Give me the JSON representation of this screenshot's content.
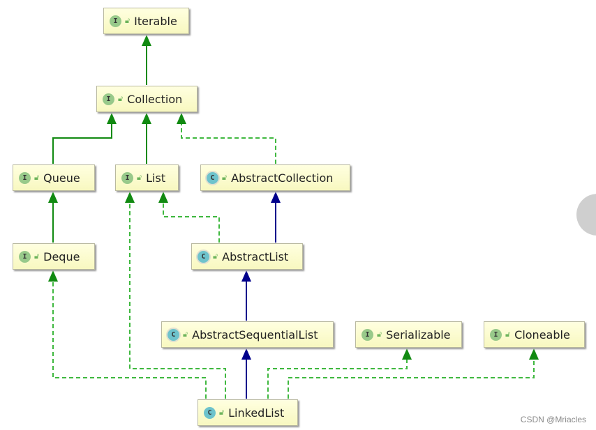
{
  "nodes": {
    "iterable": {
      "label": "Iterable",
      "kind": "interface",
      "badge": "I"
    },
    "collection": {
      "label": "Collection",
      "kind": "interface",
      "badge": "I"
    },
    "queue": {
      "label": "Queue",
      "kind": "interface",
      "badge": "I"
    },
    "list": {
      "label": "List",
      "kind": "interface",
      "badge": "I"
    },
    "abstract_collection": {
      "label": "AbstractCollection",
      "kind": "abstract-class",
      "badge": "C"
    },
    "deque": {
      "label": "Deque",
      "kind": "interface",
      "badge": "I"
    },
    "abstract_list": {
      "label": "AbstractList",
      "kind": "abstract-class",
      "badge": "C"
    },
    "abstract_sequential_list": {
      "label": "AbstractSequentialList",
      "kind": "abstract-class",
      "badge": "C"
    },
    "serializable": {
      "label": "Serializable",
      "kind": "interface",
      "badge": "I"
    },
    "cloneable": {
      "label": "Cloneable",
      "kind": "interface",
      "badge": "I"
    },
    "linked_list": {
      "label": "LinkedList",
      "kind": "class",
      "badge": "C"
    }
  },
  "edges": [
    {
      "from": "Collection",
      "to": "Iterable",
      "type": "extends-interface"
    },
    {
      "from": "Queue",
      "to": "Collection",
      "type": "extends-interface"
    },
    {
      "from": "List",
      "to": "Collection",
      "type": "extends-interface"
    },
    {
      "from": "AbstractCollection",
      "to": "Collection",
      "type": "implements"
    },
    {
      "from": "Deque",
      "to": "Queue",
      "type": "extends-interface"
    },
    {
      "from": "AbstractList",
      "to": "List",
      "type": "implements"
    },
    {
      "from": "AbstractList",
      "to": "AbstractCollection",
      "type": "extends-class"
    },
    {
      "from": "AbstractSequentialList",
      "to": "AbstractList",
      "type": "extends-class"
    },
    {
      "from": "LinkedList",
      "to": "AbstractSequentialList",
      "type": "extends-class"
    },
    {
      "from": "LinkedList",
      "to": "Deque",
      "type": "implements"
    },
    {
      "from": "LinkedList",
      "to": "List",
      "type": "implements"
    },
    {
      "from": "LinkedList",
      "to": "Serializable",
      "type": "implements"
    },
    {
      "from": "LinkedList",
      "to": "Cloneable",
      "type": "implements"
    }
  ],
  "colors": {
    "interface_edge": "#118a11",
    "class_edge": "#00008b",
    "implements_edge": "#3fb83f",
    "node_fill": "#ffffd0"
  },
  "icons": {
    "visibility": "unlock-icon"
  },
  "watermark": "CSDN @Mriacles"
}
